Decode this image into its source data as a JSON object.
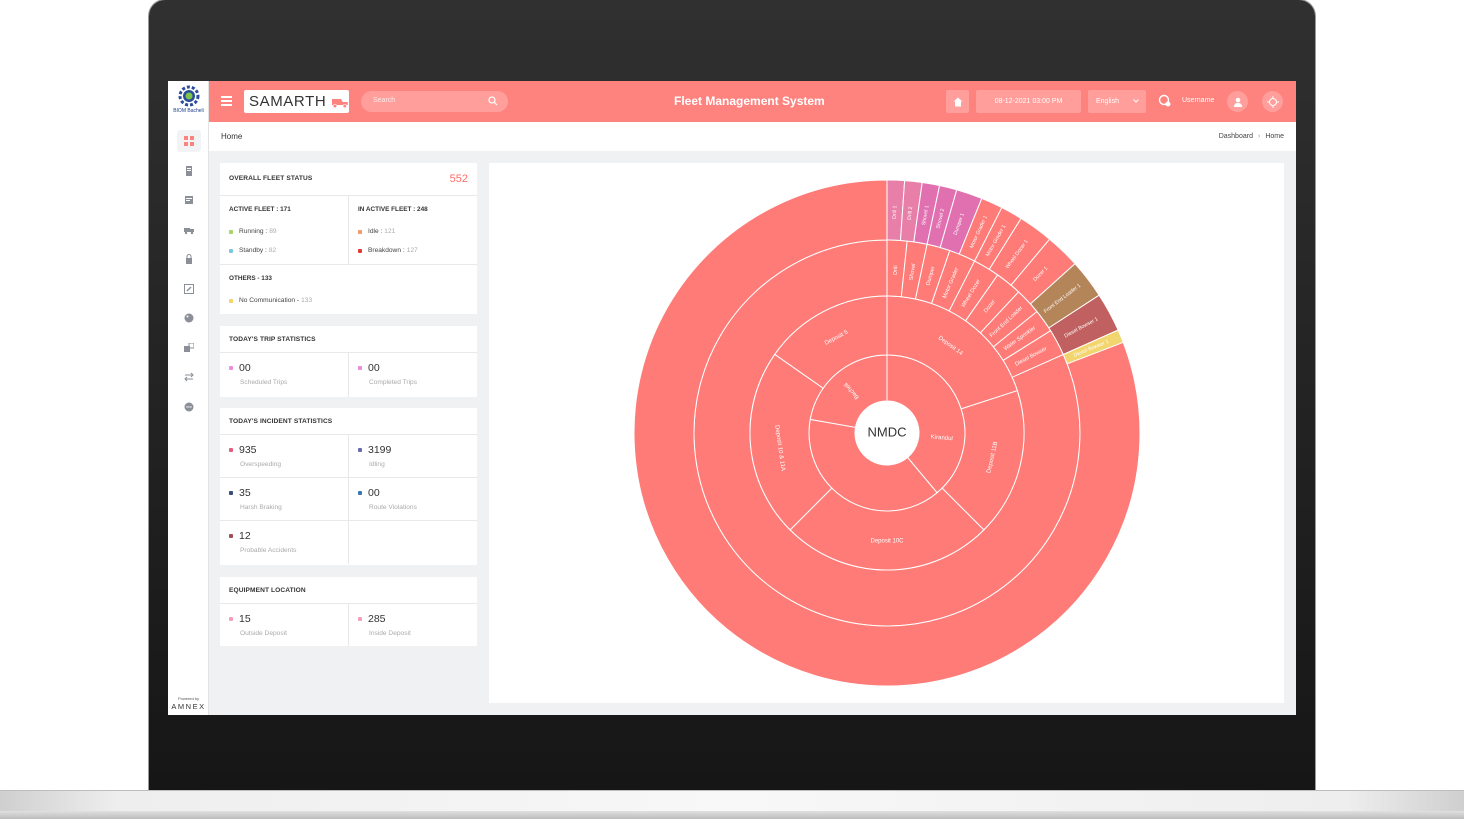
{
  "sidebar": {
    "logo_text": "BIOM Bacheli",
    "icons": [
      "dashboard-icon",
      "documents-icon",
      "reports-icon",
      "truck-icon",
      "lock-icon",
      "edit-icon",
      "palette-icon",
      "transfer-icon",
      "swap-icon",
      "chat-icon"
    ],
    "powered_by": "Powered by",
    "powered_brand": "AMNEX"
  },
  "header": {
    "brand": "SAMARTH",
    "search_placeholder": "Search",
    "title": "Fleet Management System",
    "datetime": "08-12-2021   03:00 PM",
    "language": "English",
    "username": "Username",
    "accent_color": "#fe827e"
  },
  "breadcrumb": {
    "page_title": "Home",
    "items": [
      "Dashboard",
      "Home"
    ]
  },
  "fleet_status": {
    "title": "OVERALL FLEET STATUS",
    "total": "552",
    "active_title": "ACTIVE FLEET : 171",
    "inactive_title": "IN ACTIVE FLEET : 248",
    "running_label": "Running :",
    "running_value": "89",
    "standby_label": "Standby :",
    "standby_value": "82",
    "idle_label": "Idle :",
    "idle_value": "121",
    "breakdown_label": "Breakdown :",
    "breakdown_value": "127",
    "others_title": "OTHERS - 133",
    "nocomm_label": "No Communication -",
    "nocomm_value": "133",
    "colors": {
      "running": "#a5d66b",
      "standby": "#7bc7e0",
      "idle": "#f09a6a",
      "breakdown": "#e53935",
      "nocomm": "#f5d56a"
    }
  },
  "trip_stats": {
    "title": "TODAY'S TRIP STATISTICS",
    "items": [
      {
        "value": "00",
        "label": "Scheduled Trips",
        "color": "#f08be0"
      },
      {
        "value": "00",
        "label": "Completed Trips",
        "color": "#f08be0"
      }
    ]
  },
  "incident_stats": {
    "title": "TODAY'S INCIDENT STATISTICS",
    "items": [
      {
        "value": "935",
        "label": "Overspeeding",
        "color": "#e0607e"
      },
      {
        "value": "3199",
        "label": "Idling",
        "color": "#6a6ab0"
      },
      {
        "value": "35",
        "label": "Harsh Braking",
        "color": "#3a4a7a"
      },
      {
        "value": "00",
        "label": "Route Violations",
        "color": "#3a78b0"
      },
      {
        "value": "12",
        "label": "Probable Accidents",
        "color": "#a05050"
      }
    ]
  },
  "equipment_location": {
    "title": "EQUIPMENT LOCATION",
    "items": [
      {
        "value": "15",
        "label": "Outside Deposit",
        "color": "#f5a0b8"
      },
      {
        "value": "285",
        "label": "Inside Deposit",
        "color": "#f5a0b8"
      }
    ]
  },
  "chart_data": {
    "type": "sunburst",
    "center_label": "NMDC",
    "ring1": [
      "Bacheli",
      "Kirandul"
    ],
    "ring2": [
      "Deposit 5",
      "Deposit 14",
      "Deposit 11B",
      "Deposit 10C",
      "Deposit 10 & 11A"
    ],
    "ring3": [
      "Drill",
      "Shovel",
      "Dumper",
      "Motor Grader",
      "Wheel Dozer",
      "Dozer",
      "Front End Loader",
      "Water Sprinkler",
      "Diesel Bowser"
    ],
    "ring4": [
      "Drill 1",
      "Drill 2",
      "Shovel 1",
      "Shovel 2",
      "Dumper 1",
      "Motor Grader 1",
      "Motor Grader 1",
      "Wheel Dozer 1",
      "Dozer 1",
      "Front End Loader 1",
      "Diesel Bowser 1",
      "Diesel Bowser 1"
    ],
    "colors": {
      "base": "#fe7b77",
      "drill": "#e87fa8",
      "dumper": "#e070b0",
      "loader": "#b5855a",
      "sprinkler": "#c06060",
      "bowser": "#f2d56e",
      "line": "#ffffff"
    }
  }
}
